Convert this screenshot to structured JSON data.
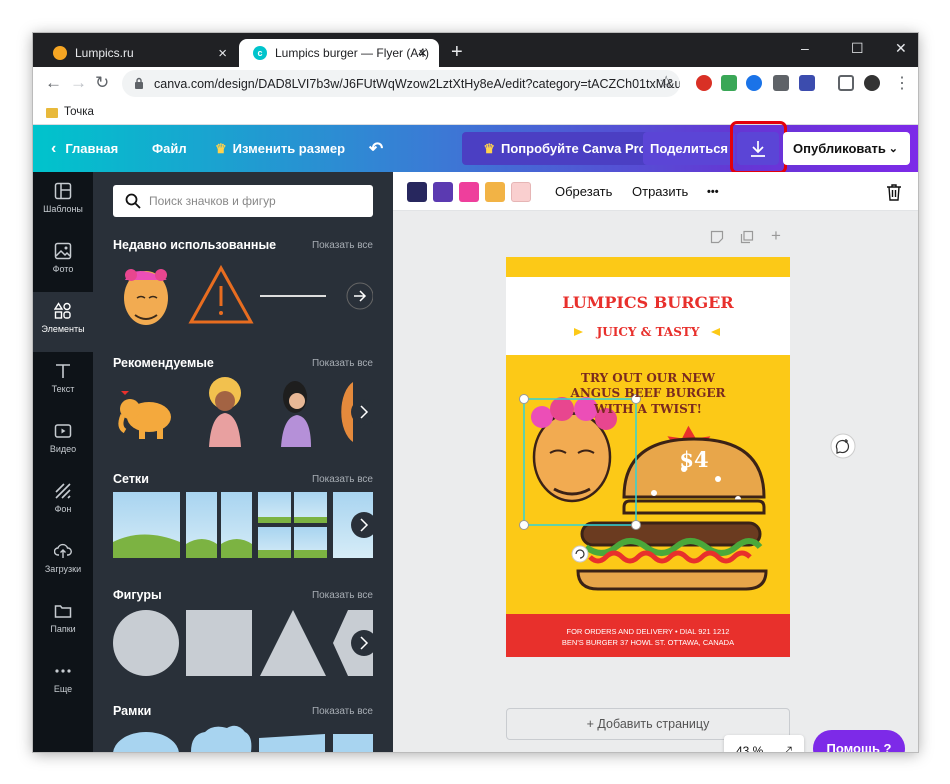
{
  "browser": {
    "tabs": [
      {
        "title": "Lumpics.ru",
        "active": false,
        "favicon_color": "#f6a623"
      },
      {
        "title": "Lumpics burger — Flyer (A4)",
        "active": true,
        "favicon_color": "#00c4cc"
      }
    ],
    "url": "canva.com/design/DAD8LVI7b3w/J6FUtWqWzow2LztXtHy8eA/edit?category=tACZCh01txM&u...",
    "bookmark": "Точка",
    "window_controls": {
      "minimize": "–",
      "maximize": "☐",
      "close": "✕"
    }
  },
  "header": {
    "home": "Главная",
    "file": "Файл",
    "resize": "Изменить размер",
    "try_pro": "Попробуйте Canva Pro",
    "share": "Поделиться",
    "download_icon": "download-icon",
    "publish": "Опубликовать",
    "highlight_color": "#e3000b"
  },
  "sidebar": {
    "items": [
      {
        "label": "Шаблоны",
        "icon": "templates-icon"
      },
      {
        "label": "Фото",
        "icon": "photo-icon"
      },
      {
        "label": "Элементы",
        "icon": "elements-icon",
        "active": true
      },
      {
        "label": "Текст",
        "icon": "text-icon"
      },
      {
        "label": "Видео",
        "icon": "video-icon"
      },
      {
        "label": "Фон",
        "icon": "background-icon"
      },
      {
        "label": "Загрузки",
        "icon": "upload-icon"
      },
      {
        "label": "Папки",
        "icon": "folder-icon"
      },
      {
        "label": "Еще",
        "icon": "more-icon"
      }
    ]
  },
  "panel": {
    "search_placeholder": "Поиск значков и фигур",
    "show_all": "Показать все",
    "sections": [
      {
        "title": "Недавно использованные"
      },
      {
        "title": "Рекомендуемые"
      },
      {
        "title": "Сетки"
      },
      {
        "title": "Фигуры"
      },
      {
        "title": "Рамки"
      }
    ]
  },
  "editbar": {
    "colors": [
      "#27275e",
      "#5b3ab1",
      "#ee3f9c",
      "#f2b345",
      "#f9cfcf"
    ],
    "crop": "Обрезать",
    "flip": "Отразить",
    "more": "•••"
  },
  "flyer": {
    "title": "LUMPICS BURGER",
    "subtitle": "JUICY & TASTY",
    "line1": "TRY OUT OUR NEW",
    "line2": "ANGUS BEEF BURGER",
    "line3": "WITH A TWIST!",
    "price": "$4",
    "footer1": "FOR ORDERS AND DELIVERY • DIAL 921 1212",
    "footer2": "BEN'S BURGER 37 HOWL ST. OTTAWA, CANADA",
    "colors": {
      "bg": "#fcc917",
      "red": "#e8302c",
      "white": "#ffffff"
    }
  },
  "canvas": {
    "add_page": "+ Добавить страницу",
    "zoom": "43 %",
    "help": "Помощь ?"
  }
}
